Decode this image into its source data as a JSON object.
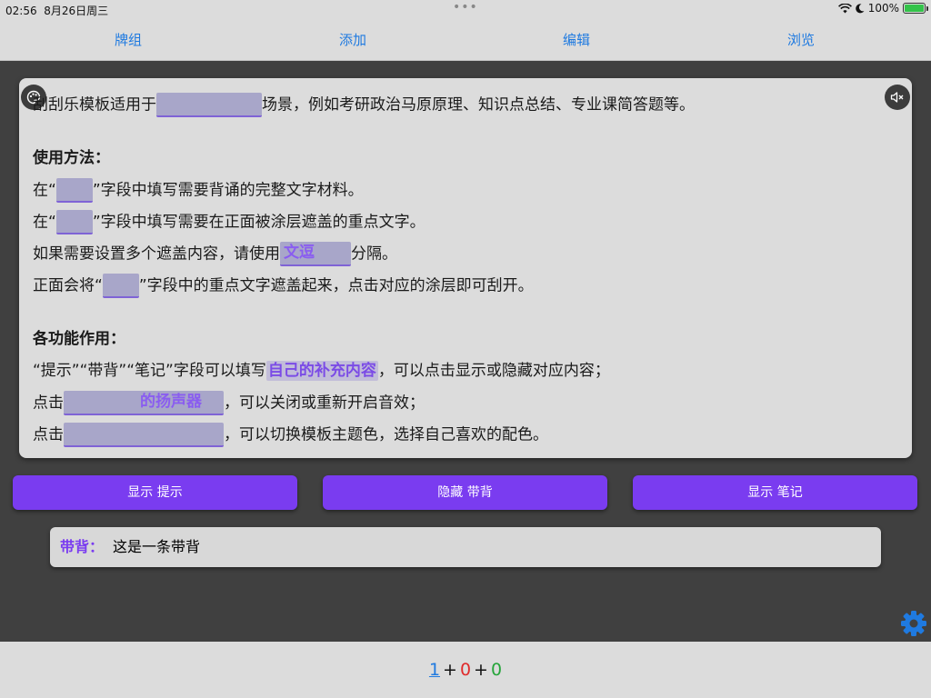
{
  "status": {
    "time": "02:56",
    "date": "8月26日周三",
    "battery": "100%",
    "battery_level": 1.0
  },
  "nav": {
    "decks": "牌组",
    "add": "添加",
    "edit": "编辑",
    "browse": "浏览"
  },
  "card": {
    "icons": {
      "palette": "palette-icon",
      "mute": "speaker-mute-icon"
    },
    "intro_pre": "刮刮乐模板适用于",
    "intro_post": "场景，例如考研政治马原原理、知识点总结、专业课简答题等。",
    "usage_heading": "使用方法：",
    "usage_1_pre": "在“",
    "usage_1_post": "”字段中填写需要背诵的完整文字材料。",
    "usage_2_pre": "在“",
    "usage_2_post": "”字段中填写需要在正面被涂层遮盖的重点文字。",
    "usage_3_pre": "如果需要设置多个遮盖内容，请使用",
    "usage_3_mask": "文逗",
    "usage_3_post": "分隔。",
    "usage_4_pre": "正面会将“",
    "usage_4_post": "”字段中的重点文字遮盖起来，点击对应的涂层即可刮开。",
    "features_heading": "各功能作用：",
    "feature_1_pre": "“提示”“带背”“笔记”字段可以填写",
    "feature_1_mark": "自己的补充内容",
    "feature_1_post": "，可以点击显示或隐藏对应内容；",
    "feature_2_pre": "点击",
    "feature_2_mask": "的扬声器",
    "feature_2_post": "，可以关闭或重新开启音效；",
    "feature_3_pre": "点击",
    "feature_3_post": "，可以切换模板主题色，选择自己喜欢的配色。"
  },
  "buttons": {
    "show_hint": "显示 提示",
    "hide_backing": "隐藏 带背",
    "show_notes": "显示 笔记"
  },
  "backing": {
    "label": "带背：",
    "text": "这是一条带背"
  },
  "settings": {
    "icon": "gear-icon",
    "color": "#1f7ae0"
  },
  "counts": {
    "new": "1",
    "learning": "0",
    "review": "0",
    "plus": "+"
  }
}
